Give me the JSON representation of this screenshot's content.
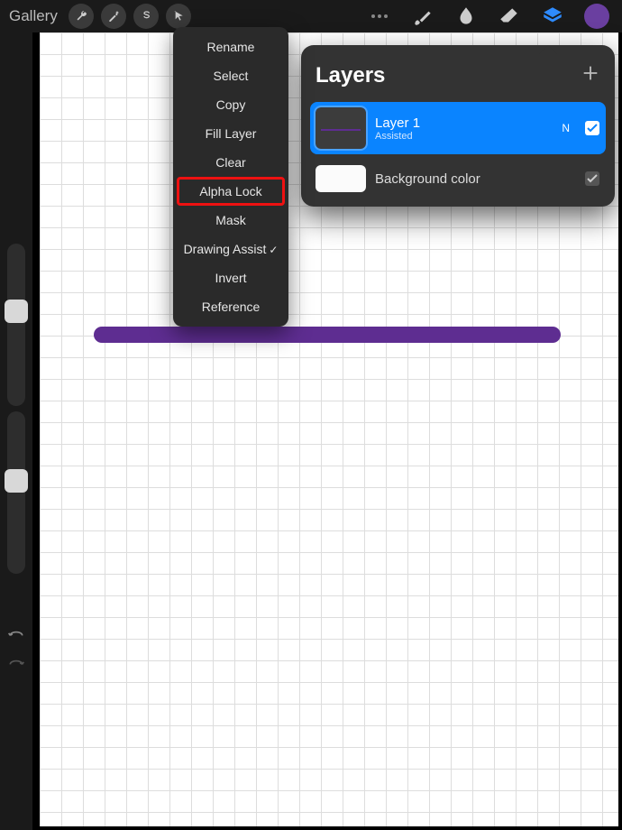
{
  "topbar": {
    "gallery": "Gallery"
  },
  "contextMenu": {
    "items": {
      "rename": "Rename",
      "select": "Select",
      "copy": "Copy",
      "fill": "Fill Layer",
      "clear": "Clear",
      "alpha": "Alpha Lock",
      "mask": "Mask",
      "drawing": "Drawing Assist",
      "invert": "Invert",
      "reference": "Reference"
    }
  },
  "layersPanel": {
    "title": "Layers",
    "layer1": {
      "name": "Layer 1",
      "subtitle": "Assisted",
      "blendBadge": "N"
    },
    "background": {
      "name": "Background color"
    }
  }
}
